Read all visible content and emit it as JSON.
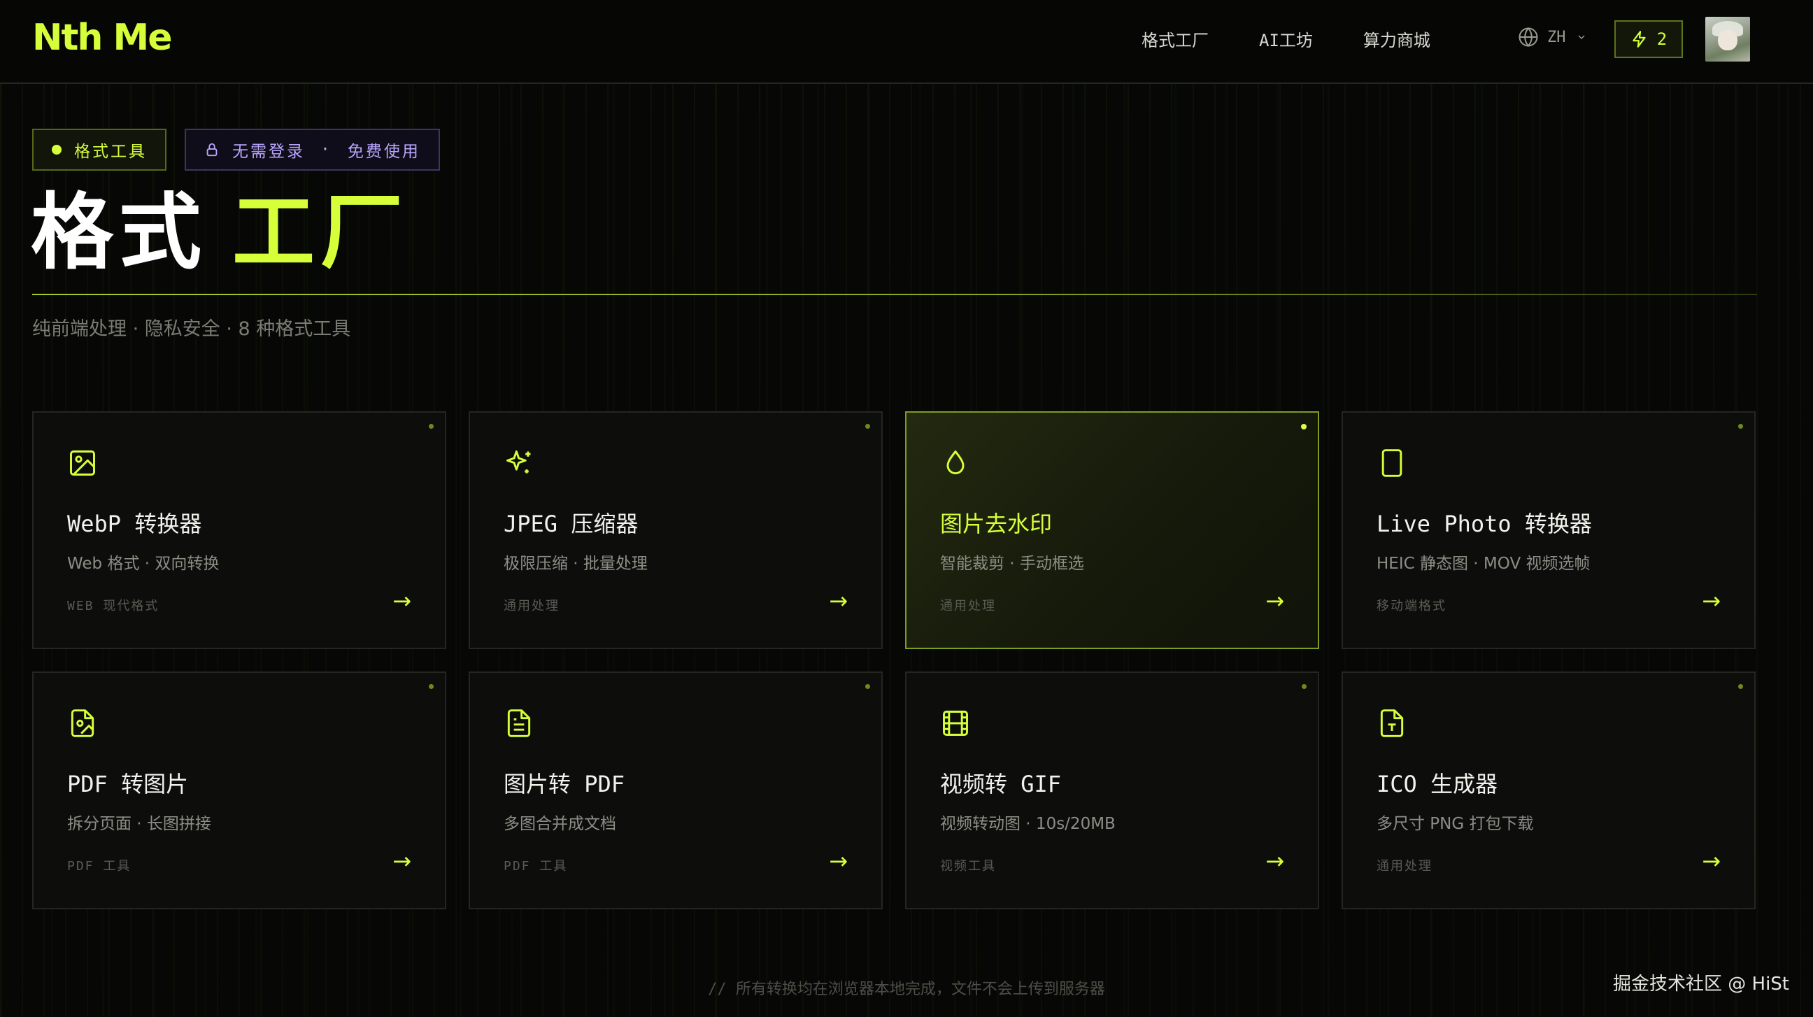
{
  "header": {
    "logo": "Nth Me",
    "nav": [
      "格式工厂",
      "AI工坊",
      "算力商城"
    ],
    "language": "ZH",
    "credits": "2"
  },
  "hero": {
    "badge_tools": "格式工具",
    "badge_free_a": "无需登录",
    "badge_sep": "·",
    "badge_free_b": "免费使用",
    "title_main": "格式",
    "title_accent": "工厂",
    "subtitle": "纯前端处理 · 隐私安全 · 8 种格式工具"
  },
  "cards": [
    {
      "icon": "image-icon",
      "title": "WebP 转换器",
      "desc": "Web 格式 · 双向转换",
      "tag": "WEB 现代格式",
      "arrow": "→"
    },
    {
      "icon": "sparkles-icon",
      "title": "JPEG 压缩器",
      "desc": "极限压缩 · 批量处理",
      "tag": "通用处理",
      "arrow": "→"
    },
    {
      "icon": "droplet-icon",
      "title": "图片去水印",
      "desc": "智能裁剪 · 手动框选",
      "tag": "通用处理",
      "arrow": "→"
    },
    {
      "icon": "phone-icon",
      "title": "Live Photo 转换器",
      "desc": "HEIC 静态图 · MOV 视频选帧",
      "tag": "移动端格式",
      "arrow": "→"
    },
    {
      "icon": "file-image-icon",
      "title": "PDF 转图片",
      "desc": "拆分页面 · 长图拼接",
      "tag": "PDF 工具",
      "arrow": "→"
    },
    {
      "icon": "file-text-icon",
      "title": "图片转 PDF",
      "desc": "多图合并成文档",
      "tag": "PDF 工具",
      "arrow": "→"
    },
    {
      "icon": "film-icon",
      "title": "视频转 GIF",
      "desc": "视频转动图 · 10s/20MB",
      "tag": "视频工具",
      "arrow": "→"
    },
    {
      "icon": "file-type-icon",
      "title": "ICO 生成器",
      "desc": "多尺寸 PNG 打包下载",
      "tag": "通用处理",
      "arrow": "→"
    }
  ],
  "active_card": 2,
  "footer_note": "// 所有转换均在浏览器本地完成，文件不会上传到服务器",
  "watermark": "掘金技术社区 @ HiSt",
  "colors": {
    "accent": "#d6ff3a",
    "background": "#070806",
    "purple": "#b9a6ff",
    "card_border": "#24261f"
  }
}
